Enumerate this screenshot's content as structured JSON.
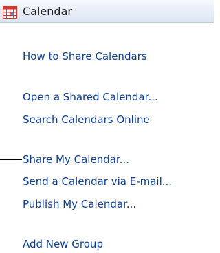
{
  "header": {
    "title": "Calendar",
    "icon": "calendar-grid-icon"
  },
  "links": [
    {
      "label": "How to Share Calendars"
    },
    {
      "label": "Open a Shared Calendar..."
    },
    {
      "label": "Search Calendars Online"
    },
    {
      "label": "Share My Calendar..."
    },
    {
      "label": "Send a Calendar via E-mail..."
    },
    {
      "label": "Publish My Calendar..."
    },
    {
      "label": "Add New Group"
    }
  ],
  "colors": {
    "link": "#0b3d91",
    "icon_red": "#d9342b",
    "icon_blue": "#5b8fd6"
  }
}
